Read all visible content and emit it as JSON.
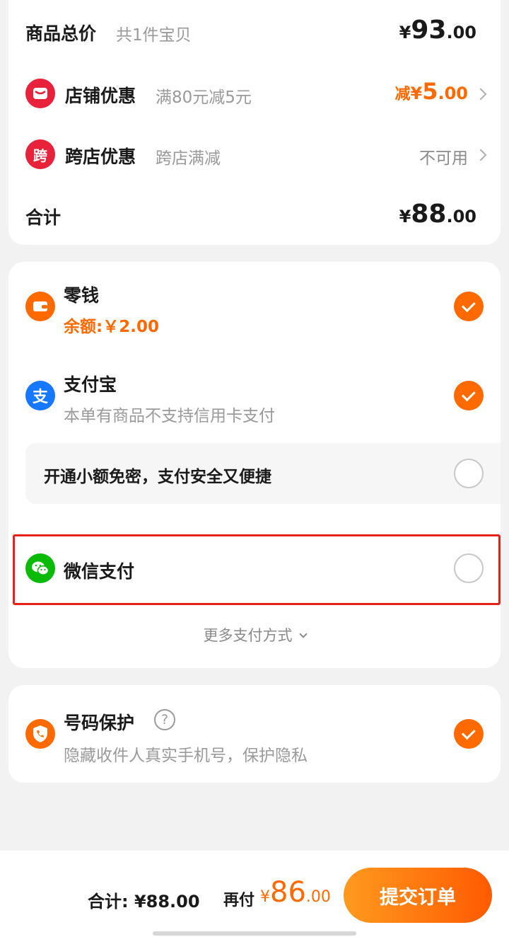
{
  "summary": {
    "total_label": "商品总价",
    "total_count": "共1件宝贝",
    "total_currency": "¥",
    "total_int": "93",
    "total_dec": ".00",
    "shop_label": "店铺优惠",
    "shop_desc": "满80元减5元",
    "shop_prefix": "减",
    "shop_currency": "¥",
    "shop_int": "5",
    "shop_dec": ".00",
    "cross_icon": "跨",
    "cross_label": "跨店优惠",
    "cross_desc": "跨店满减",
    "cross_status": "不可用",
    "sum_label": "合计",
    "sum_currency": "¥",
    "sum_int": "88",
    "sum_dec": ".00"
  },
  "payment": {
    "change_label": "零钱",
    "change_balance": "余额:￥2.00",
    "alipay_icon": "支",
    "alipay_label": "支付宝",
    "alipay_note": "本单有商品不支持信用卡支付",
    "nopwd_label": "开通小额免密，支付安全又便捷",
    "wechat_label": "微信支付",
    "more_label": "更多支付方式"
  },
  "protect": {
    "label": "号码保护",
    "help": "?",
    "desc": "隐藏收件人真实手机号，保护隐私"
  },
  "footer": {
    "total_text": "合计: ¥88.00",
    "pay_label": "再付",
    "pay_currency": "¥",
    "pay_int": "86",
    "pay_dec": ".00",
    "submit_label": "提交订单"
  },
  "colors": {
    "accent": "#ff6a00",
    "highlight": "#e8201a",
    "alipay": "#1677ff",
    "wechat": "#09bb07",
    "shop_icon": "#e8223a"
  },
  "icons": [
    "shop-icon",
    "cross-store-icon",
    "wallet-icon",
    "alipay-icon",
    "wechat-icon",
    "phone-shield-icon",
    "help-icon",
    "check-icon",
    "radio-icon",
    "chevron-right-icon",
    "chevron-down-icon"
  ]
}
